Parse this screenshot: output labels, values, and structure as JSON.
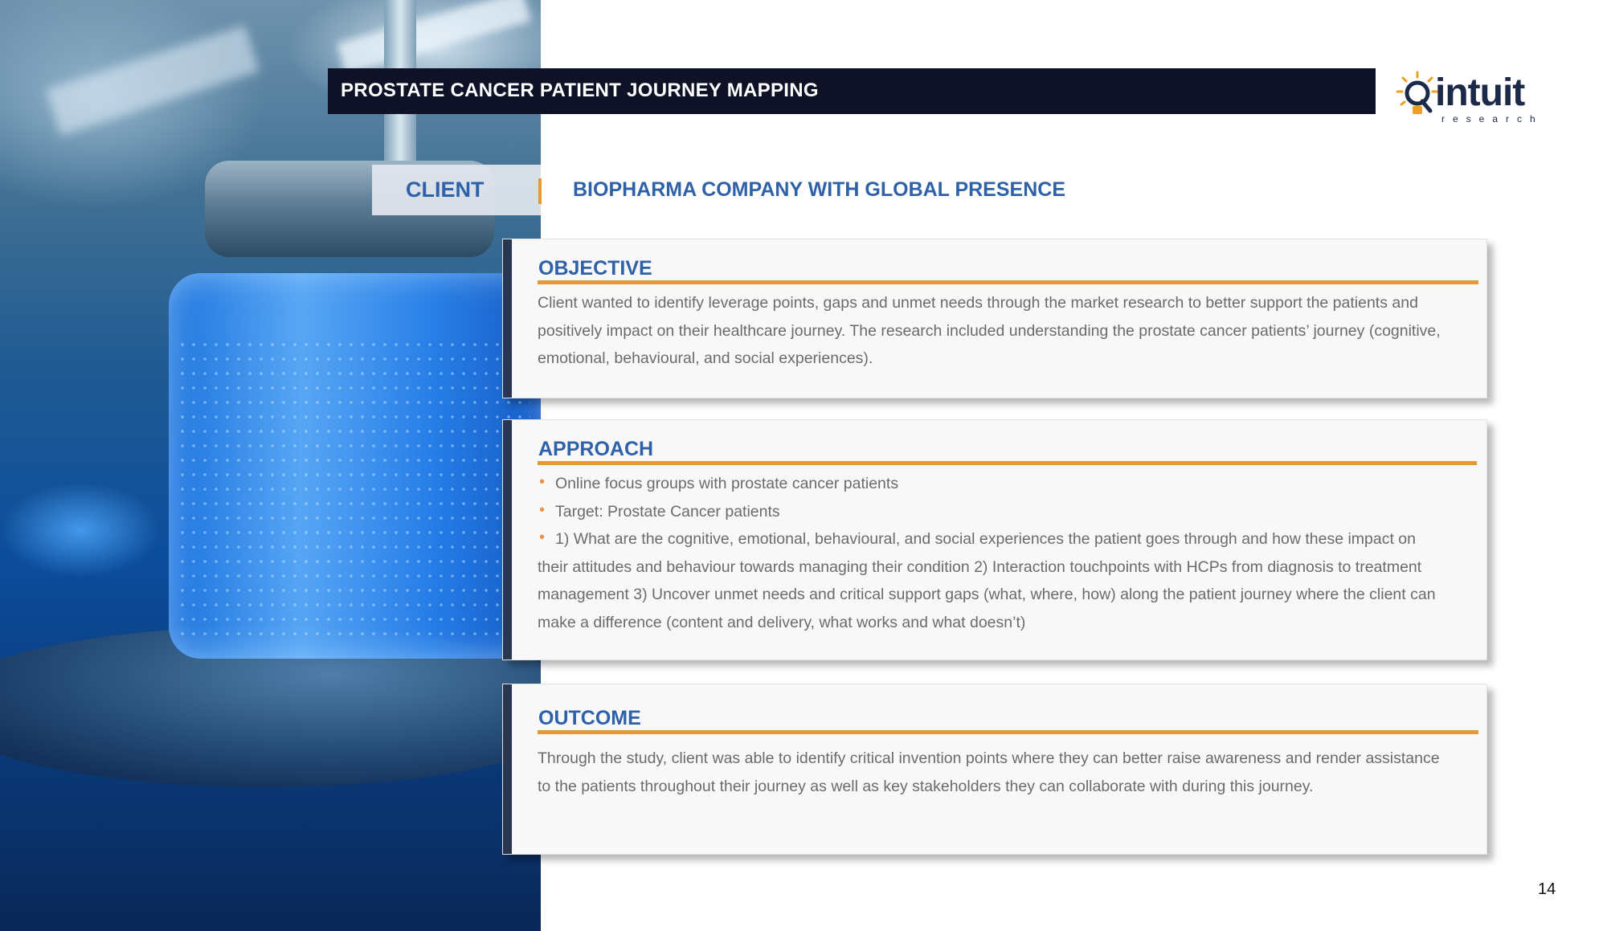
{
  "header": {
    "title": "PROSTATE CANCER PATIENT JOURNEY MAPPING"
  },
  "logo": {
    "name": "intuit",
    "tagline": "research",
    "icon": "lightbulb-icon",
    "accent": "#f0a020"
  },
  "client": {
    "label": "CLIENT",
    "value": "BIOPHARMA COMPANY WITH GLOBAL PRESENCE"
  },
  "objective": {
    "heading": "OBJECTIVE",
    "text": "Client wanted to identify leverage points, gaps and unmet needs through the market research to better support the patients and positively impact on their healthcare journey. The research included understanding the prostate cancer patients’ journey (cognitive, emotional, behavioural, and social experiences)."
  },
  "approach": {
    "heading": "APPROACH",
    "bullets": [
      "Online focus groups with prostate cancer patients",
      "Target: Prostate Cancer patients",
      "1) What are the cognitive, emotional, behavioural, and social experiences the patient goes through and how these impact on their attitudes and behaviour towards managing their condition 2) Interaction touchpoints with HCPs from diagnosis to treatment management 3) Uncover unmet needs and critical support gaps (what, where, how) along the patient journey where the client can make a difference (content and delivery, what works and what doesn’t)"
    ]
  },
  "outcome": {
    "heading": "OUTCOME",
    "text": "Through the study, client was able to identify critical invention points where they can better raise awareness and render assistance to the patients throughout their journey as well as key stakeholders they can collaborate with during this journey."
  },
  "page_number": "14",
  "colors": {
    "title_bar": "#0f1226",
    "heading_blue": "#2f61a8",
    "accent_orange": "#e29a36",
    "body_text": "#6b6b6b"
  }
}
